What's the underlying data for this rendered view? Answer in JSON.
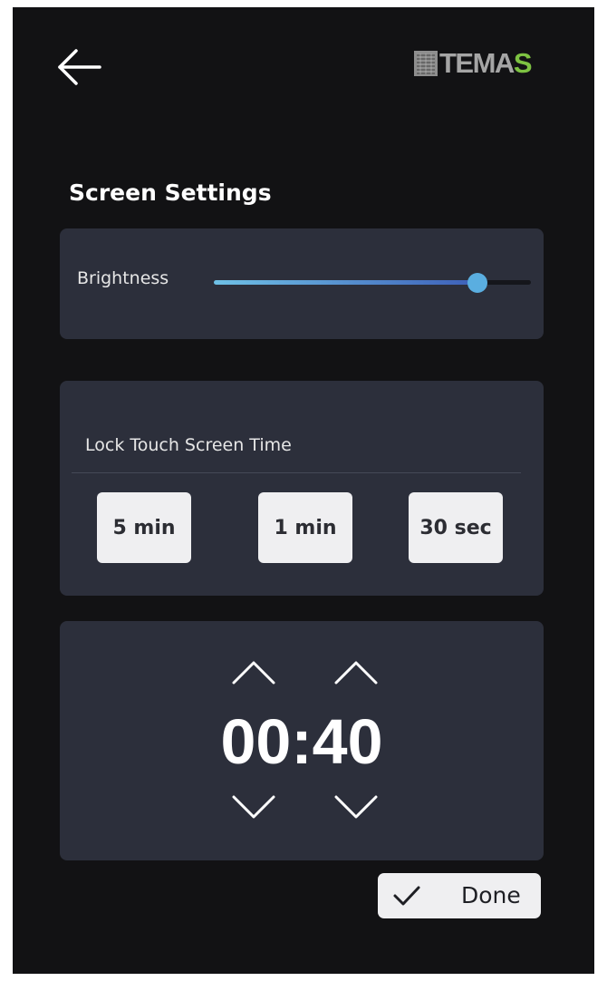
{
  "header": {
    "back_icon": "arrow-left-icon",
    "logo_text_main": "TEMA",
    "logo_text_accent": "S",
    "logo_colors": {
      "main": "#a5a5a5",
      "accent": "#7dc242"
    }
  },
  "page": {
    "title": "Screen Settings"
  },
  "brightness": {
    "label": "Brightness",
    "value_fraction": 0.83,
    "accent_color": "#5aaee0"
  },
  "lock": {
    "title": "Lock Touch Screen Time",
    "options": [
      {
        "label": "5 min"
      },
      {
        "label": "1 min"
      },
      {
        "label": "30 sec"
      }
    ]
  },
  "timer": {
    "value": "00:40",
    "up_icon": "chevron-up-icon",
    "down_icon": "chevron-down-icon"
  },
  "actions": {
    "done_label": "Done",
    "done_icon": "checkmark-icon"
  },
  "colors": {
    "background": "#121214",
    "card": "#2c2f3b",
    "button": "#efeff1"
  }
}
